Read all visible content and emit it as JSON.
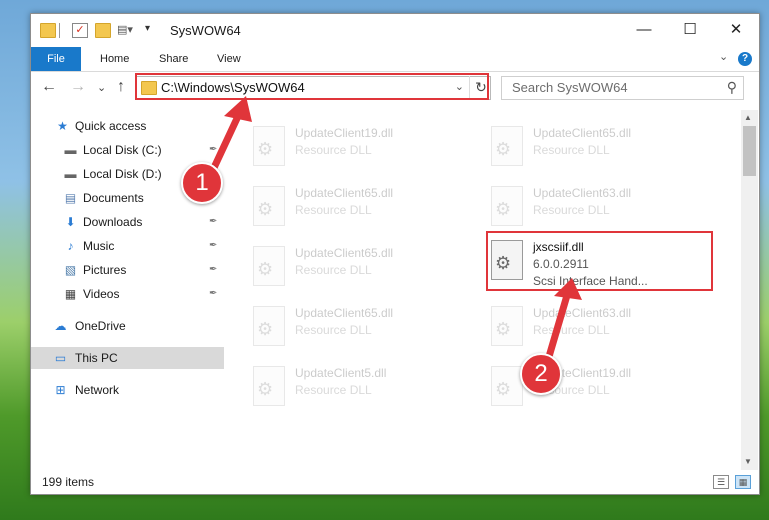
{
  "window": {
    "title": "SysWOW64",
    "minimize_glyph": "—",
    "maximize_glyph": "☐",
    "close_glyph": "✕"
  },
  "ribbon": {
    "tabs": [
      {
        "label": "File",
        "active": true
      },
      {
        "label": "Home"
      },
      {
        "label": "Share"
      },
      {
        "label": "View"
      }
    ],
    "help_glyph": "?",
    "expand_glyph": "⌄"
  },
  "nav": {
    "back_glyph": "←",
    "forward_glyph": "→",
    "recent_glyph": "⌄",
    "up_glyph": "↑",
    "address": "C:\\Windows\\SysWOW64",
    "address_drop_glyph": "⌄",
    "refresh_glyph": "↻",
    "search_placeholder": "Search SysWOW64",
    "search_glyph": "⚲"
  },
  "sidebar": {
    "items": [
      {
        "label": "Quick access",
        "icon": "star-icon",
        "glyph": "★",
        "color": "#2b7cd3"
      },
      {
        "label": "Local Disk (C:)",
        "icon": "drive-icon",
        "glyph": "▬",
        "color": "#666666",
        "pinned": true
      },
      {
        "label": "Local Disk (D:)",
        "icon": "drive-icon",
        "glyph": "▬",
        "color": "#666666",
        "pinned": true
      },
      {
        "label": "Documents",
        "icon": "documents-icon",
        "glyph": "▤",
        "color": "#5a7fb0",
        "pinned": true
      },
      {
        "label": "Downloads",
        "icon": "download-icon",
        "glyph": "⬇",
        "color": "#2b7cd3",
        "pinned": true
      },
      {
        "label": "Music",
        "icon": "music-icon",
        "glyph": "♪",
        "color": "#2b7cd3",
        "pinned": true
      },
      {
        "label": "Pictures",
        "icon": "pictures-icon",
        "glyph": "▧",
        "color": "#4a7aa8",
        "pinned": true
      },
      {
        "label": "Videos",
        "icon": "videos-icon",
        "glyph": "▦",
        "color": "#444444",
        "pinned": true
      },
      {
        "label": "OneDrive",
        "icon": "cloud-icon",
        "glyph": "☁",
        "color": "#2b7cd3"
      },
      {
        "label": "This PC",
        "icon": "computer-icon",
        "glyph": "▭",
        "color": "#2b7cd3",
        "selected": true
      },
      {
        "label": "Network",
        "icon": "network-icon",
        "glyph": "⊞",
        "color": "#2b7cd3"
      }
    ],
    "pin_glyph": "📌"
  },
  "files": [
    {
      "name": "UpdateClient19.dll",
      "line2": "Resource DLL",
      "faded": true
    },
    {
      "name": "UpdateClient65.dll",
      "line2": "Resource DLL",
      "faded": true
    },
    {
      "name": "UpdateClient65.dll",
      "line2": "Resource DLL",
      "faded": true
    },
    {
      "name": "UpdateClient63.dll",
      "line2": "Resource DLL",
      "faded": true
    },
    {
      "name": "UpdateClient65.dll",
      "line2": "Resource DLL",
      "faded": true
    },
    {
      "name": "jxscsiif.dll",
      "line2": "6.0.0.2911",
      "line3": "Scsi Interface Hand...",
      "faded": false
    },
    {
      "name": "UpdateClient65.dll",
      "line2": "Resource DLL",
      "faded": true
    },
    {
      "name": "UpdateClient63.dll",
      "line2": "Resource DLL",
      "faded": true
    },
    {
      "name": "UpdateClient5.dll",
      "line2": "Resource DLL",
      "faded": true
    },
    {
      "name": "UpdateClient19.dll",
      "line2": "Resource DLL",
      "faded": true
    }
  ],
  "status": {
    "items_count": "199 items"
  },
  "callouts": {
    "badge1": "1",
    "badge2": "2",
    "color": "#e0353a"
  }
}
